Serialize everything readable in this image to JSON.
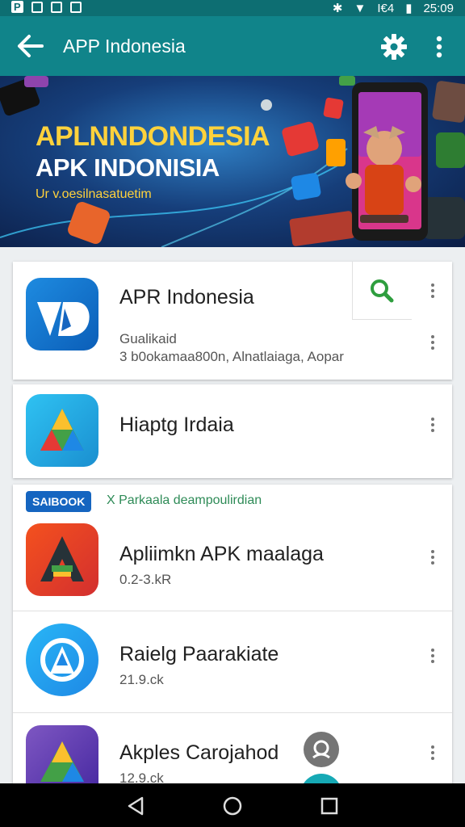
{
  "status_bar": {
    "left_text": "P",
    "time": "25:09",
    "signal_text": "Ι€4"
  },
  "app_bar": {
    "title": "APP Indonesia",
    "back_icon": "back-arrow-icon",
    "settings_icon": "gear-icon",
    "menu_icon": "more-vert-icon"
  },
  "banner": {
    "headline": "APLNNDONDESIA",
    "title": "APK INDONISIA",
    "tagline": "Ur v.oesilnasatuetim"
  },
  "apps": [
    {
      "name": "APR Indonesia",
      "category": "Gualikaid",
      "details": "3 b0okamaa800n, Alnatlaiaga, Aopar",
      "icon_colors": [
        "#0b66c3",
        "#1e8be0"
      ]
    },
    {
      "name": "Hiaptg Irdaia",
      "icon_colors": [
        "#1aa7e0",
        "#2fc2f2"
      ]
    }
  ],
  "section": {
    "badge": "SAIBOOK",
    "label": "X Parkaala deampoulirdian",
    "apps": [
      {
        "name": "Apliimkn APK maalaga",
        "size": "0.2-3.kR",
        "icon_colors": [
          "#e53935",
          "#f4511e"
        ]
      },
      {
        "name": "Raielg Paarakiate",
        "size": "21.9.ck",
        "icon_colors": [
          "#1e88e5",
          "#29b6f6"
        ]
      },
      {
        "name": "Akples Carojahod",
        "size": "12.9.ck",
        "icon_colors": [
          "#5e35b1",
          "#7e57c2"
        ]
      }
    ]
  },
  "colors": {
    "app_bar": "#10848a",
    "accent_green": "#2e9e3e",
    "badge_blue": "#1565c0"
  }
}
